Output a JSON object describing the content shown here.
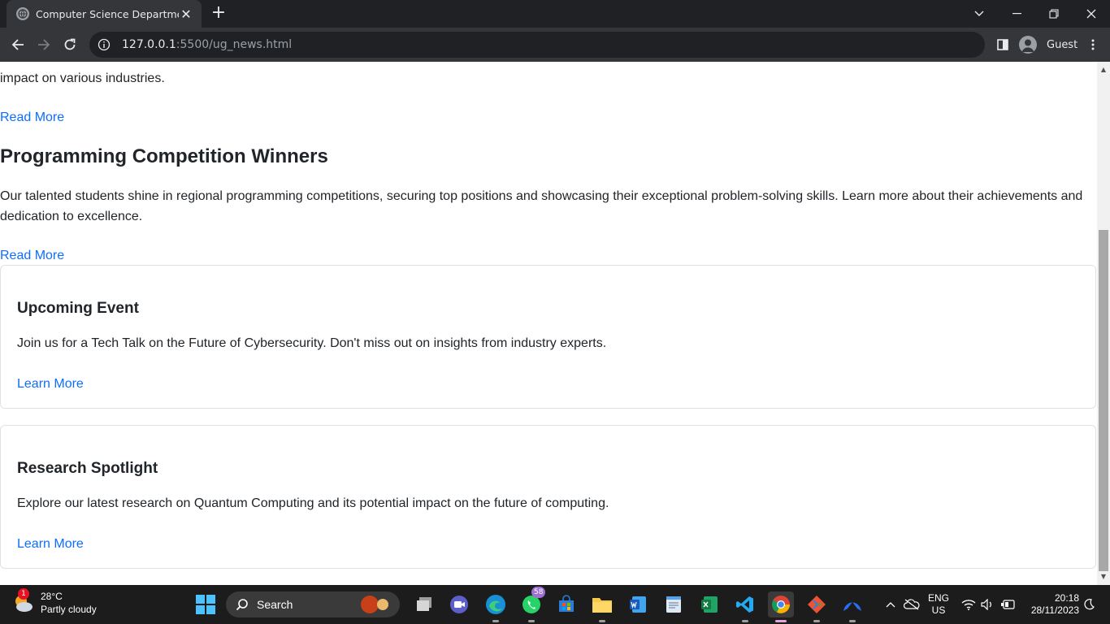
{
  "browser": {
    "tab_title": "Computer Science Department",
    "new_tab": "+",
    "close_tab": "✕",
    "url_host": "127.0.0.1",
    "url_path": ":5500/ug_news.html",
    "profile_name": "Guest"
  },
  "page": {
    "partial_paragraph_end": "impact on various industries.",
    "read_more_1": "Read More",
    "news_heading": "Programming Competition Winners",
    "news_text_line1": "Our talented students shine in regional programming competitions, securing top positions and showcasing their exceptional problem-solving skills. Learn more about their achievements and",
    "news_text_line2": "dedication to excellence.",
    "read_more_2": "Read More",
    "cards": [
      {
        "title": "Upcoming Event",
        "text": "Join us for a Tech Talk on the Future of Cybersecurity. Don't miss out on insights from industry experts.",
        "link": "Learn More"
      },
      {
        "title": "Research Spotlight",
        "text": "Explore our latest research on Quantum Computing and its potential impact on the future of computing.",
        "link": "Learn More"
      }
    ]
  },
  "taskbar": {
    "weather_temp": "28°C",
    "weather_desc": "Partly cloudy",
    "weather_badge": "1",
    "search_label": "Search",
    "whatsapp_badge": "58",
    "lang_top": "ENG",
    "lang_bottom": "US",
    "time": "20:18",
    "date": "28/11/2023"
  },
  "colors": {
    "link": "#0d6efd",
    "chrome_dark": "#202124",
    "chrome_toolbar": "#35363a",
    "taskbar": "#1c1c1c"
  }
}
